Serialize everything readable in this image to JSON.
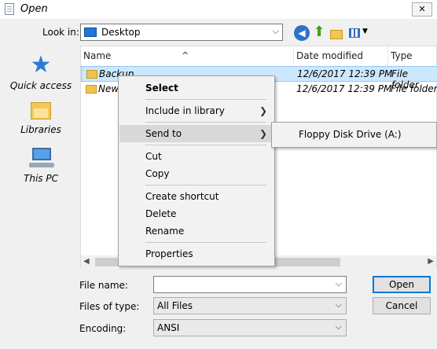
{
  "window": {
    "title": "Open",
    "close_glyph": "✕"
  },
  "lookin": {
    "label": "Look in:",
    "value": "Desktop"
  },
  "toolbar": {
    "icons": [
      "back-icon",
      "up-folder-icon",
      "new-folder-icon",
      "view-menu-icon"
    ]
  },
  "places": [
    {
      "label": "Quick access",
      "icon": "star-icon"
    },
    {
      "label": "Libraries",
      "icon": "libraries-icon"
    },
    {
      "label": "This PC",
      "icon": "computer-icon"
    }
  ],
  "columns": {
    "name": "Name",
    "date": "Date modified",
    "type": "Type"
  },
  "rows": [
    {
      "name": "Backup",
      "date": "12/6/2017 12:39 PM",
      "type": "File folder"
    },
    {
      "name": "New",
      "date": "12/6/2017 12:39 PM",
      "type": "File folder"
    }
  ],
  "context_menu": {
    "select": "Select",
    "include": "Include in library",
    "send_to": "Send to",
    "cut": "Cut",
    "copy": "Copy",
    "create_shortcut": "Create shortcut",
    "delete": "Delete",
    "rename": "Rename",
    "properties": "Properties"
  },
  "submenu": {
    "floppy": "Floppy Disk Drive (A:)"
  },
  "form": {
    "filename_label": "File name:",
    "filename_value": "",
    "filetype_label": "Files of type:",
    "filetype_value": "All Files",
    "encoding_label": "Encoding:",
    "encoding_value": "ANSI"
  },
  "buttons": {
    "open": "Open",
    "cancel": "Cancel"
  }
}
